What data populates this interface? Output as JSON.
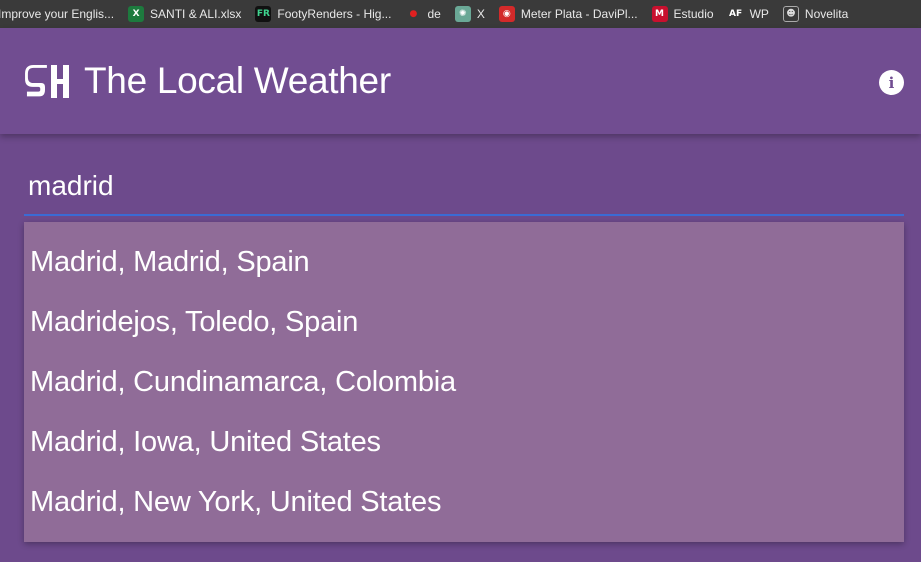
{
  "bookmarks": [
    {
      "label": "Improve your Englis...",
      "icon": "none"
    },
    {
      "label": "SANTI & ALI.xlsx",
      "icon": "excel-icon"
    },
    {
      "label": "FootyRenders - Hig...",
      "icon": "footyrenders-icon"
    },
    {
      "label": "de",
      "icon": "red-drop-icon"
    },
    {
      "label": "X",
      "icon": "openai-icon"
    },
    {
      "label": "Meter Plata - DaviPl...",
      "icon": "piggybank-icon"
    },
    {
      "label": "Estudio",
      "icon": "mega-icon"
    },
    {
      "label": "WP",
      "icon": "af-icon"
    },
    {
      "label": "Novelita",
      "icon": "novelita-icon"
    }
  ],
  "app": {
    "title": "The Local Weather",
    "info_icon": "i"
  },
  "search": {
    "value": "madrid",
    "placeholder": ""
  },
  "suggestions": [
    "Madrid, Madrid, Spain",
    "Madridejos, Toledo, Spain",
    "Madrid, Cundinamarca, Colombia",
    "Madrid, Iowa, United States",
    "Madrid, New York, United States"
  ],
  "colors": {
    "background": "#6d4a8c",
    "appbar": "#714d91",
    "suggestions_bg": "#906c98",
    "underline": "#3b6bd4"
  }
}
